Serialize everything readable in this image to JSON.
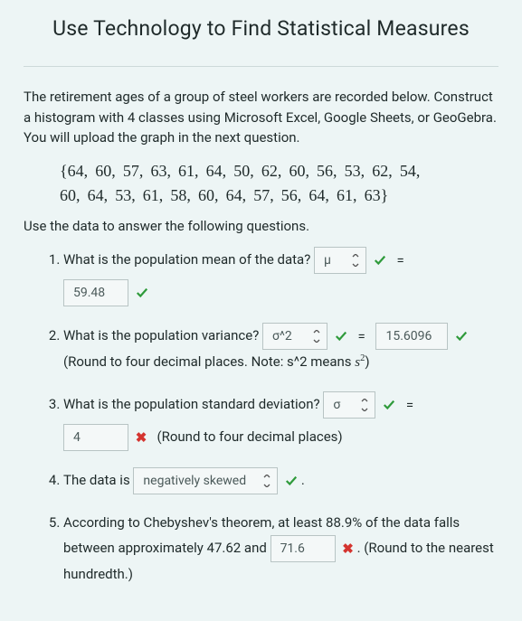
{
  "title": "Use Technology to Find Statistical Measures",
  "intro": "The retirement ages of a group of steel workers are recorded below. Construct a histogram with 4 classes using Microsoft Excel, Google Sheets, or GeoGebra. You will upload the graph in the next question.",
  "dataset_line1": "{64,  60,  57,  63,  61,  64,  50,  62,  60,  56,  53,  62,  54,",
  "dataset_line2": "60,  64,  53,  61,  58,  60,  64,  57,  56,  64,  61,  63}",
  "lead2": "Use the data to answer the following questions.",
  "eq": "=",
  "period": ".",
  "q1": {
    "text": "What is the population mean of the data?",
    "symbol": "μ",
    "value": "59.48",
    "symbol_ok": true,
    "value_ok": true
  },
  "q2": {
    "text": "What is the population variance?",
    "symbol": "σ^2",
    "value": "15.6096",
    "note_a": "(Round to four decimal places. Note: s^2 means ",
    "note_b": ")",
    "symbol_ok": true,
    "value_ok": true
  },
  "q3": {
    "text": "What is the population standard deviation?",
    "symbol": "σ",
    "value": "4",
    "note": "(Round to four decimal places)",
    "symbol_ok": true,
    "value_ok": false
  },
  "q4": {
    "text_a": "The data is",
    "value": "negatively skewed",
    "ok": true
  },
  "q5": {
    "text_a": "According to Chebyshev's theorem, at least 88.9% of the data falls between approximately 47.62 and ",
    "value": "71.6",
    "ok": false,
    "text_b": ". (Round to the nearest hundredth.)"
  }
}
